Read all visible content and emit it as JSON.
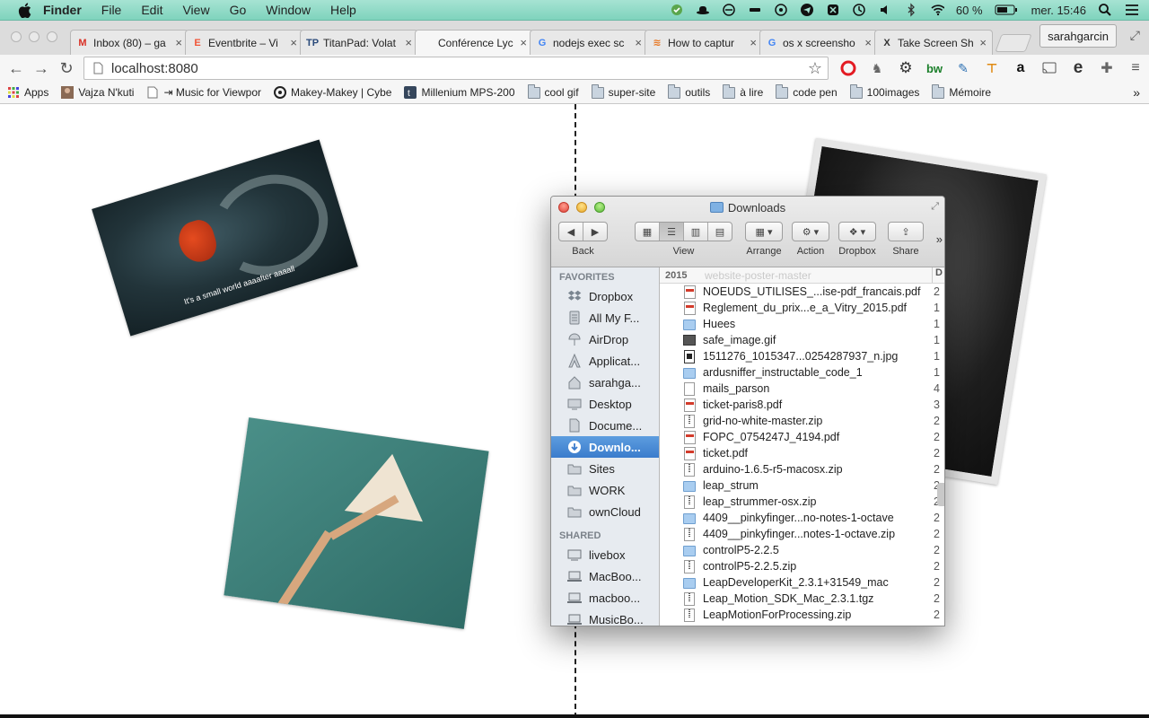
{
  "menubar": {
    "app": "Finder",
    "items": [
      "File",
      "Edit",
      "View",
      "Go",
      "Window",
      "Help"
    ],
    "battery": "60 %",
    "datetime": "mer. 15:46"
  },
  "browser": {
    "tabs": [
      {
        "label": "Inbox (80) – ga",
        "fav": "M",
        "favcolor": "#d93025"
      },
      {
        "label": "Eventbrite – Vi",
        "fav": "E",
        "favcolor": "#f05537"
      },
      {
        "label": "TitanPad: Volat",
        "fav": "TP",
        "favcolor": "#2a4a7a"
      },
      {
        "label": "Conférence Lyc",
        "fav": "",
        "favcolor": "#888888"
      },
      {
        "label": "nodejs exec sc",
        "fav": "G",
        "favcolor": "#4285f4"
      },
      {
        "label": "How to captur",
        "fav": "≋",
        "favcolor": "#e87722"
      },
      {
        "label": "os x screensho",
        "fav": "G",
        "favcolor": "#4285f4"
      },
      {
        "label": "Take Screen Sh",
        "fav": "X",
        "favcolor": "#333333"
      }
    ],
    "profile": "sarahgarcin",
    "url": "localhost:8080",
    "bookmarks": [
      {
        "label": "Apps",
        "kind": "apps"
      },
      {
        "label": "Vajza N'kuti",
        "kind": "img"
      },
      {
        "label": "⇥ Music for Viewpor",
        "kind": "page"
      },
      {
        "label": "Makey-Makey | Cybe",
        "kind": "circle"
      },
      {
        "label": "Millenium MPS-200",
        "kind": "t"
      },
      {
        "label": "cool gif",
        "kind": "folder"
      },
      {
        "label": "super-site",
        "kind": "folder"
      },
      {
        "label": "outils",
        "kind": "folder"
      },
      {
        "label": "à lire",
        "kind": "folder"
      },
      {
        "label": "code pen",
        "kind": "folder"
      },
      {
        "label": "100images",
        "kind": "folder"
      },
      {
        "label": "Mémoire",
        "kind": "folder"
      }
    ]
  },
  "page": {
    "caption": "It's a small world aaaafter aaaall"
  },
  "finder": {
    "title": "Downloads",
    "toolbar": {
      "back": "Back",
      "view": "View",
      "arrange": "Arrange",
      "action": "Action",
      "dropbox": "Dropbox",
      "share": "Share"
    },
    "favorites_label": "FAVORITES",
    "shared_label": "SHARED",
    "favorites": [
      {
        "label": "Dropbox",
        "icon": "dropbox-icon"
      },
      {
        "label": "All My F...",
        "icon": "all-files-icon"
      },
      {
        "label": "AirDrop",
        "icon": "airdrop-icon"
      },
      {
        "label": "Applicat...",
        "icon": "applications-icon"
      },
      {
        "label": "sarahga...",
        "icon": "home-icon"
      },
      {
        "label": "Desktop",
        "icon": "desktop-icon"
      },
      {
        "label": "Docume...",
        "icon": "documents-icon"
      },
      {
        "label": "Downlo...",
        "icon": "downloads-icon"
      },
      {
        "label": "Sites",
        "icon": "folder-icon"
      },
      {
        "label": "WORK",
        "icon": "folder-icon"
      },
      {
        "label": "ownCloud",
        "icon": "folder-icon"
      }
    ],
    "shared": [
      {
        "label": "livebox",
        "icon": "network-drive-icon"
      },
      {
        "label": "MacBoo...",
        "icon": "computer-icon"
      },
      {
        "label": "macboo...",
        "icon": "computer-icon"
      },
      {
        "label": "MusicBo...",
        "icon": "computer-icon"
      }
    ],
    "group_year": "2015",
    "group_hint": "website-poster-master",
    "column_header": "D",
    "files": [
      {
        "name": "NOEUDS_UTILISES_...ise-pdf_francais.pdf",
        "kind": "pdf",
        "date": "2"
      },
      {
        "name": "Reglement_du_prix...e_a_Vitry_2015.pdf",
        "kind": "pdf",
        "date": "1"
      },
      {
        "name": "Huees",
        "kind": "folder",
        "date": "1"
      },
      {
        "name": "safe_image.gif",
        "kind": "img",
        "date": "1"
      },
      {
        "name": "1511276_1015347...0254287937_n.jpg",
        "kind": "jpg",
        "date": "1"
      },
      {
        "name": "ardusniffer_instructable_code_1",
        "kind": "folder",
        "date": "1"
      },
      {
        "name": "mails_parson",
        "kind": "file",
        "date": "4"
      },
      {
        "name": "ticket-paris8.pdf",
        "kind": "pdf",
        "date": "3"
      },
      {
        "name": "grid-no-white-master.zip",
        "kind": "zip",
        "date": "2"
      },
      {
        "name": "FOPC_0754247J_4194.pdf",
        "kind": "pdf",
        "date": "2"
      },
      {
        "name": "ticket.pdf",
        "kind": "pdf",
        "date": "2"
      },
      {
        "name": "arduino-1.6.5-r5-macosx.zip",
        "kind": "zip",
        "date": "2"
      },
      {
        "name": "leap_strum",
        "kind": "folder",
        "date": "2"
      },
      {
        "name": "leap_strummer-osx.zip",
        "kind": "zip",
        "date": "2"
      },
      {
        "name": "4409__pinkyfinger...no-notes-1-octave",
        "kind": "folder",
        "date": "2"
      },
      {
        "name": "4409__pinkyfinger...notes-1-octave.zip",
        "kind": "zip",
        "date": "2"
      },
      {
        "name": "controlP5-2.2.5",
        "kind": "folder",
        "date": "2"
      },
      {
        "name": "controlP5-2.2.5.zip",
        "kind": "zip",
        "date": "2"
      },
      {
        "name": "LeapDeveloperKit_2.3.1+31549_mac",
        "kind": "folder",
        "date": "2"
      },
      {
        "name": "Leap_Motion_SDK_Mac_2.3.1.tgz",
        "kind": "zip",
        "date": "2"
      },
      {
        "name": "LeapMotionForProcessing.zip",
        "kind": "zip",
        "date": "2"
      }
    ]
  }
}
